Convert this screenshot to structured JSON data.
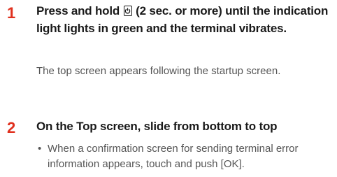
{
  "steps": [
    {
      "number": "1",
      "heading_before_icon": "Press and hold",
      "icon": "power-button-icon",
      "heading_after_icon": "(2 sec. or more) until the indication light lights in green and the terminal vibrates.",
      "body": "The top screen appears following the startup screen."
    },
    {
      "number": "2",
      "heading": "On the Top screen, slide from bottom to top",
      "bullets": [
        {
          "mark": "•",
          "text": "When a confirmation screen for sending terminal error information appears, touch and push [OK]."
        }
      ]
    }
  ],
  "colors": {
    "step_number": "#e0301e",
    "heading": "#1a1a1a",
    "body": "#555555"
  }
}
